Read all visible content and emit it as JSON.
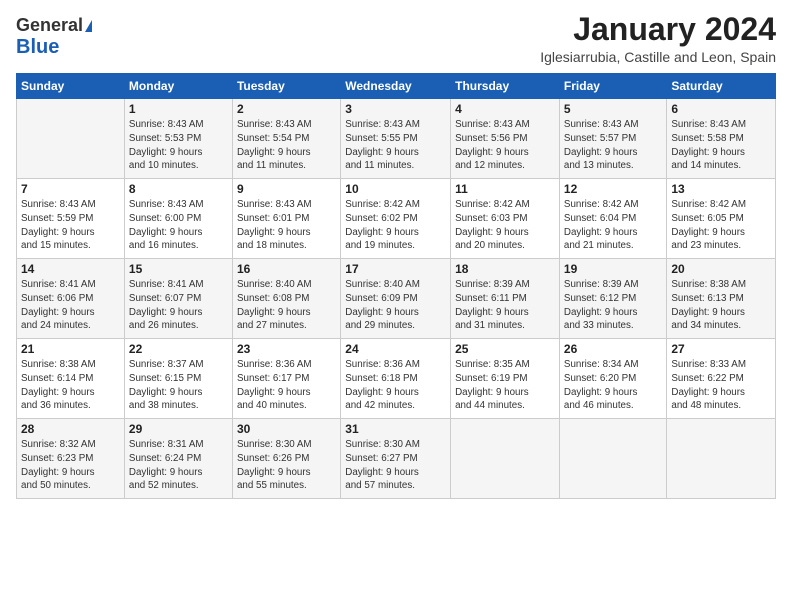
{
  "header": {
    "logo_line1": "General",
    "logo_line2": "Blue",
    "month_title": "January 2024",
    "location": "Iglesiarrubia, Castille and Leon, Spain"
  },
  "days_of_week": [
    "Sunday",
    "Monday",
    "Tuesday",
    "Wednesday",
    "Thursday",
    "Friday",
    "Saturday"
  ],
  "weeks": [
    [
      {
        "num": "",
        "info": ""
      },
      {
        "num": "1",
        "info": "Sunrise: 8:43 AM\nSunset: 5:53 PM\nDaylight: 9 hours\nand 10 minutes."
      },
      {
        "num": "2",
        "info": "Sunrise: 8:43 AM\nSunset: 5:54 PM\nDaylight: 9 hours\nand 11 minutes."
      },
      {
        "num": "3",
        "info": "Sunrise: 8:43 AM\nSunset: 5:55 PM\nDaylight: 9 hours\nand 11 minutes."
      },
      {
        "num": "4",
        "info": "Sunrise: 8:43 AM\nSunset: 5:56 PM\nDaylight: 9 hours\nand 12 minutes."
      },
      {
        "num": "5",
        "info": "Sunrise: 8:43 AM\nSunset: 5:57 PM\nDaylight: 9 hours\nand 13 minutes."
      },
      {
        "num": "6",
        "info": "Sunrise: 8:43 AM\nSunset: 5:58 PM\nDaylight: 9 hours\nand 14 minutes."
      }
    ],
    [
      {
        "num": "7",
        "info": "Sunrise: 8:43 AM\nSunset: 5:59 PM\nDaylight: 9 hours\nand 15 minutes."
      },
      {
        "num": "8",
        "info": "Sunrise: 8:43 AM\nSunset: 6:00 PM\nDaylight: 9 hours\nand 16 minutes."
      },
      {
        "num": "9",
        "info": "Sunrise: 8:43 AM\nSunset: 6:01 PM\nDaylight: 9 hours\nand 18 minutes."
      },
      {
        "num": "10",
        "info": "Sunrise: 8:42 AM\nSunset: 6:02 PM\nDaylight: 9 hours\nand 19 minutes."
      },
      {
        "num": "11",
        "info": "Sunrise: 8:42 AM\nSunset: 6:03 PM\nDaylight: 9 hours\nand 20 minutes."
      },
      {
        "num": "12",
        "info": "Sunrise: 8:42 AM\nSunset: 6:04 PM\nDaylight: 9 hours\nand 21 minutes."
      },
      {
        "num": "13",
        "info": "Sunrise: 8:42 AM\nSunset: 6:05 PM\nDaylight: 9 hours\nand 23 minutes."
      }
    ],
    [
      {
        "num": "14",
        "info": "Sunrise: 8:41 AM\nSunset: 6:06 PM\nDaylight: 9 hours\nand 24 minutes."
      },
      {
        "num": "15",
        "info": "Sunrise: 8:41 AM\nSunset: 6:07 PM\nDaylight: 9 hours\nand 26 minutes."
      },
      {
        "num": "16",
        "info": "Sunrise: 8:40 AM\nSunset: 6:08 PM\nDaylight: 9 hours\nand 27 minutes."
      },
      {
        "num": "17",
        "info": "Sunrise: 8:40 AM\nSunset: 6:09 PM\nDaylight: 9 hours\nand 29 minutes."
      },
      {
        "num": "18",
        "info": "Sunrise: 8:39 AM\nSunset: 6:11 PM\nDaylight: 9 hours\nand 31 minutes."
      },
      {
        "num": "19",
        "info": "Sunrise: 8:39 AM\nSunset: 6:12 PM\nDaylight: 9 hours\nand 33 minutes."
      },
      {
        "num": "20",
        "info": "Sunrise: 8:38 AM\nSunset: 6:13 PM\nDaylight: 9 hours\nand 34 minutes."
      }
    ],
    [
      {
        "num": "21",
        "info": "Sunrise: 8:38 AM\nSunset: 6:14 PM\nDaylight: 9 hours\nand 36 minutes."
      },
      {
        "num": "22",
        "info": "Sunrise: 8:37 AM\nSunset: 6:15 PM\nDaylight: 9 hours\nand 38 minutes."
      },
      {
        "num": "23",
        "info": "Sunrise: 8:36 AM\nSunset: 6:17 PM\nDaylight: 9 hours\nand 40 minutes."
      },
      {
        "num": "24",
        "info": "Sunrise: 8:36 AM\nSunset: 6:18 PM\nDaylight: 9 hours\nand 42 minutes."
      },
      {
        "num": "25",
        "info": "Sunrise: 8:35 AM\nSunset: 6:19 PM\nDaylight: 9 hours\nand 44 minutes."
      },
      {
        "num": "26",
        "info": "Sunrise: 8:34 AM\nSunset: 6:20 PM\nDaylight: 9 hours\nand 46 minutes."
      },
      {
        "num": "27",
        "info": "Sunrise: 8:33 AM\nSunset: 6:22 PM\nDaylight: 9 hours\nand 48 minutes."
      }
    ],
    [
      {
        "num": "28",
        "info": "Sunrise: 8:32 AM\nSunset: 6:23 PM\nDaylight: 9 hours\nand 50 minutes."
      },
      {
        "num": "29",
        "info": "Sunrise: 8:31 AM\nSunset: 6:24 PM\nDaylight: 9 hours\nand 52 minutes."
      },
      {
        "num": "30",
        "info": "Sunrise: 8:30 AM\nSunset: 6:26 PM\nDaylight: 9 hours\nand 55 minutes."
      },
      {
        "num": "31",
        "info": "Sunrise: 8:30 AM\nSunset: 6:27 PM\nDaylight: 9 hours\nand 57 minutes."
      },
      {
        "num": "",
        "info": ""
      },
      {
        "num": "",
        "info": ""
      },
      {
        "num": "",
        "info": ""
      }
    ]
  ]
}
